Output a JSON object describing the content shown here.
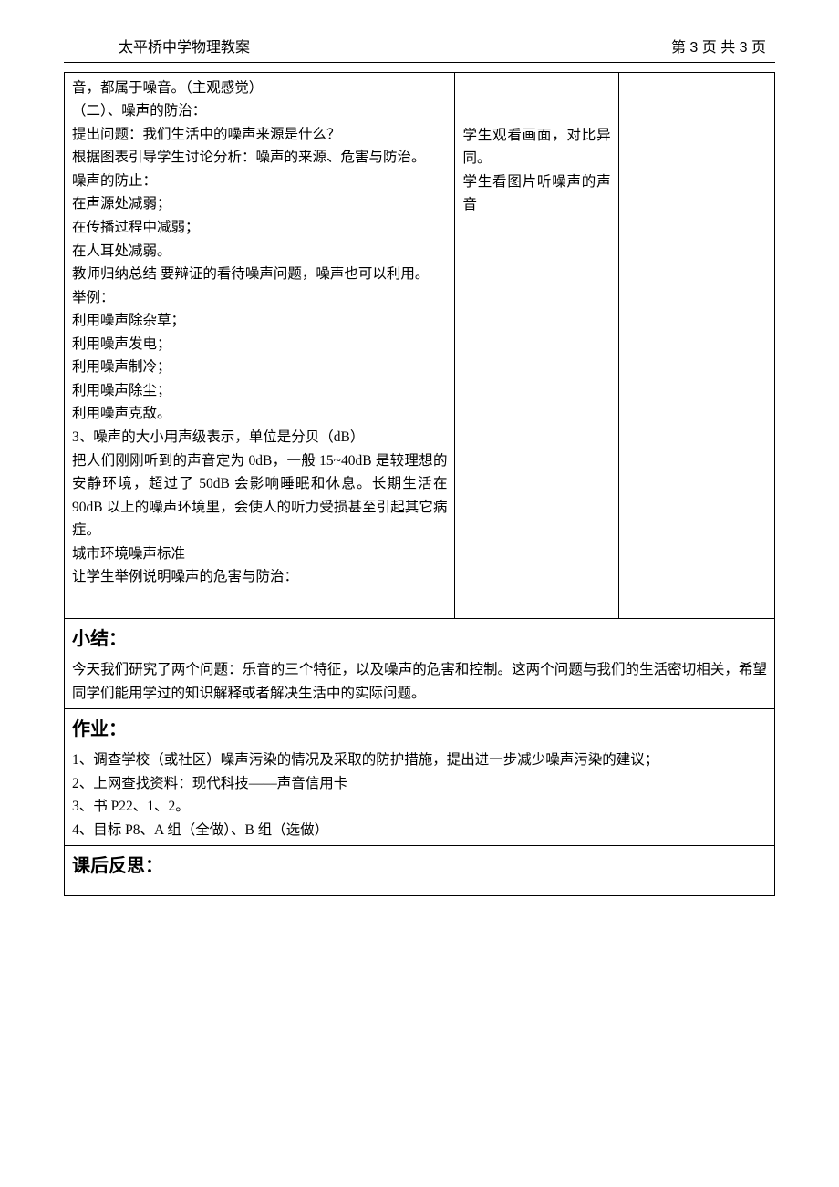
{
  "header": {
    "left": "太平桥中学物理教案",
    "right": "第 3 页 共 3 页"
  },
  "top_block": {
    "left_lines": [
      "音，都属于噪音。（主观感觉）",
      "（二）、噪声的防治：",
      "提出问题：我们生活中的噪声来源是什么？",
      "根据图表引导学生讨论分析：噪声的来源、危害与防治。",
      "噪声的防止：",
      "在声源处减弱；",
      "在传播过程中减弱；",
      "在人耳处减弱。",
      "教师归纳总结 要辩证的看待噪声问题，噪声也可以利用。",
      "举例：",
      "利用噪声除杂草；",
      "利用噪声发电；",
      "利用噪声制冷；",
      "利用噪声除尘；",
      "利用噪声克敌。",
      "3、噪声的大小用声级表示，单位是分贝（dB）",
      "把人们刚刚听到的声音定为 0dB，一般 15~40dB 是较理想的安静环境，超过了 50dB 会影响睡眠和休息。长期生活在 90dB 以上的噪声环境里，会使人的听力受损甚至引起其它病症。",
      "城市环境噪声标准",
      "让学生举例说明噪声的危害与防治："
    ],
    "mid_lines": [
      "学生观看画面，对比异同。",
      "学生看图片听噪声的声音"
    ]
  },
  "summary": {
    "title": "小结：",
    "body": "今天我们研究了两个问题：乐音的三个特征，以及噪声的危害和控制。这两个问题与我们的生活密切相关，希望同学们能用学过的知识解释或者解决生活中的实际问题。"
  },
  "homework": {
    "title": "作业：",
    "items": [
      "1、调查学校（或社区）噪声污染的情况及采取的防护措施，提出进一步减少噪声污染的建议；",
      "2、上网查找资料：现代科技——声音信用卡",
      "3、书 P22、1、2。",
      "4、目标 P8、A 组（全做）、B 组（选做）"
    ]
  },
  "reflection": {
    "title": "课后反思："
  }
}
